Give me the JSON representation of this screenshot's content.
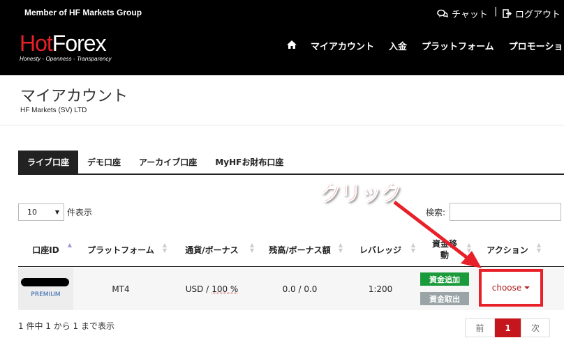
{
  "header": {
    "member_text": "Member of HF Markets Group",
    "chat_label": "チャット",
    "separator": "|",
    "logout_label": "ログアウト",
    "logo": {
      "hot": "Hot",
      "forex": "Forex",
      "tagline": "Honesty - Openness - Transparency"
    },
    "nav": [
      {
        "icon": "home-icon"
      },
      {
        "label": "マイアカウント"
      },
      {
        "label": "入金"
      },
      {
        "label": "プラットフォーム"
      },
      {
        "label": "プロモーション"
      }
    ]
  },
  "page": {
    "title": "マイアカウント",
    "subtitle": "HF Markets (SV) LTD"
  },
  "tabs": [
    {
      "label": "ライブ口座",
      "active": true
    },
    {
      "label": "デモ口座"
    },
    {
      "label": "アーカイブ口座"
    },
    {
      "label": "MyHFお財布口座"
    }
  ],
  "controls": {
    "page_length": "10",
    "page_length_suffix": "件表示",
    "search_label": "検索:",
    "search_value": ""
  },
  "annotation": {
    "callout": "クリック",
    "color": "#e8202a"
  },
  "table": {
    "columns": [
      "口座ID",
      "プラットフォーム",
      "通貨/ボーナス",
      "残高/ボーナス額",
      "レバレッジ",
      "資金移動",
      "アクション"
    ],
    "rows": [
      {
        "account_type": "PREMIUM",
        "platform": "MT4",
        "currency": "USD /",
        "bonus": "100 %",
        "balance": "0.0 / 0.0",
        "leverage": "1:200",
        "deposit_button": "資金追加",
        "withdraw_button": "資金取出",
        "action": "choose"
      }
    ],
    "info": "1 件中 1 から 1 まで表示"
  },
  "pagination": {
    "prev": "前",
    "current": "1",
    "next": "次"
  },
  "colors": {
    "accent": "#e8202a",
    "deposit": "#1a9a3b",
    "withdraw": "#9aa4a6",
    "current_page": "#c4161c"
  }
}
